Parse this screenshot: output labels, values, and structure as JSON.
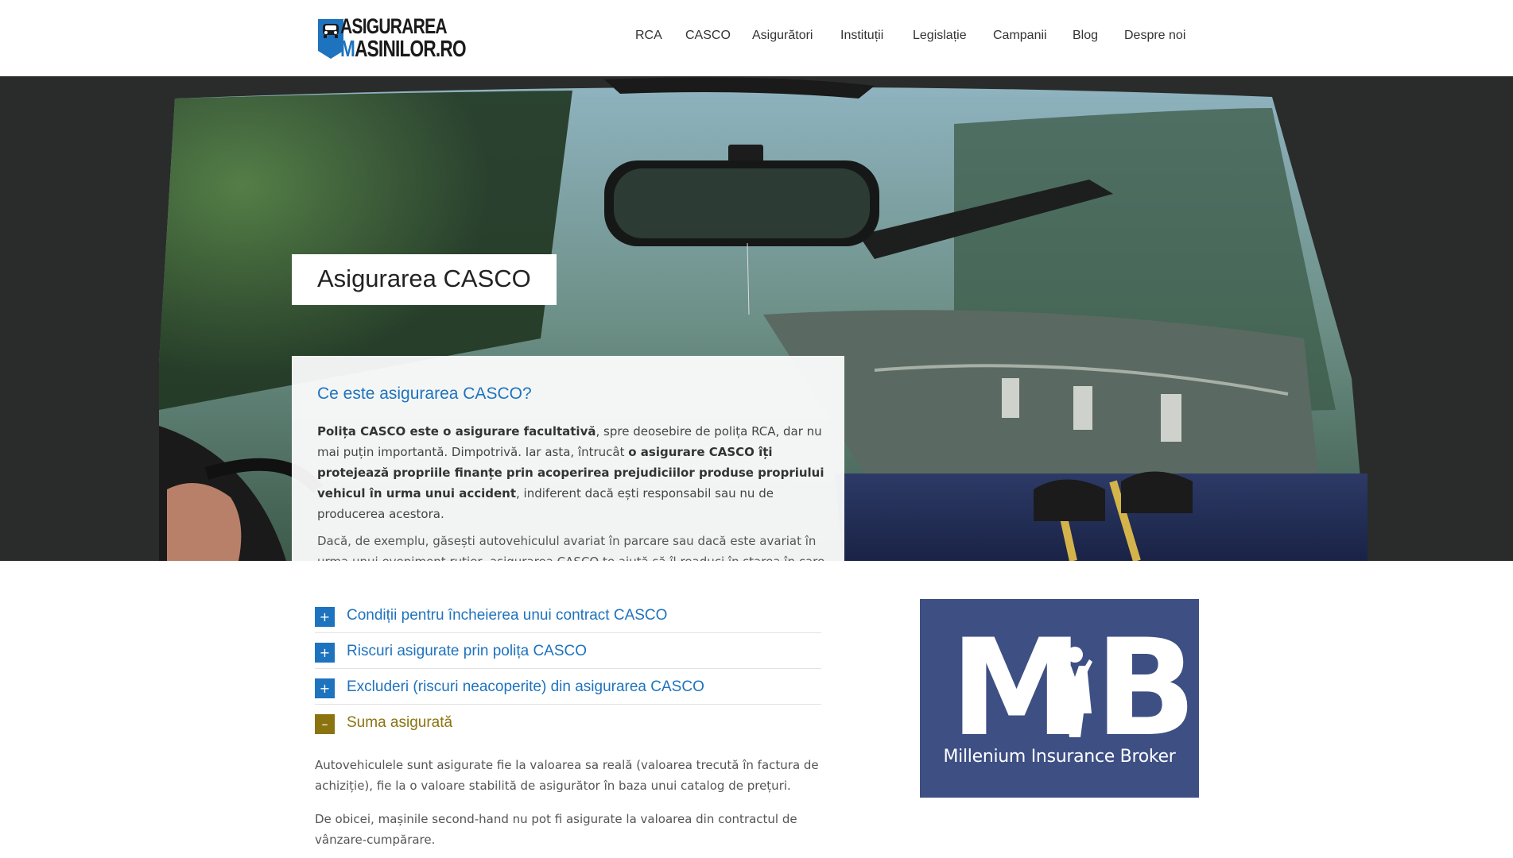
{
  "logo": {
    "line1": "ASIGURAREA",
    "line2_first": "M",
    "line2_rest": "ASINILOR.RO"
  },
  "nav": [
    "RCA",
    "CASCO",
    "Asigurători",
    "Instituții",
    "Legislație",
    "Campanii",
    "Blog",
    "Despre noi"
  ],
  "hero": {
    "title": "Asigurarea CASCO"
  },
  "intro": {
    "heading": "Ce este asigurarea CASCO?",
    "p1_bold1": "Polița CASCO este o asigurare facultativă",
    "p1_text1": ", spre deosebire de polița RCA, dar nu mai puțin importantă. Dimpotrivă. Iar asta, întrucât ",
    "p1_bold2": "o asigurare CASCO îți protejează propriile finanțe prin acoperirea prejudiciilor produse propriului vehicul în urma unui accident",
    "p1_text2": ", indiferent dacă ești responsabil sau nu de producerea acestora.",
    "p2": "Dacă, de exemplu, găsești autovehiculul avariat în parcare sau dacă este avariat în urma unui eveniment rutier, asigurarea CASCO te ajută să îl readuci în starea în care era înaintea incidentului. Totodată, polița CASCO acoperă și alte riscuri, precum furtul mașinii sau al părților componente."
  },
  "accordion": {
    "items": [
      {
        "label": "Condiții pentru încheierea unui contract CASCO",
        "toggle": "+"
      },
      {
        "label": "Riscuri asigurate prin polița CASCO",
        "toggle": "+"
      },
      {
        "label": "Excluderi (riscuri neacoperite) din asigurarea CASCO",
        "toggle": "+"
      },
      {
        "label": "Suma asigurată",
        "toggle": "–"
      }
    ],
    "open_body": [
      "Autovehiculele sunt asigurate fie la valoarea sa reală (valoarea trecută în factura de achiziție), fie la o valoare stabilită de asigurător în baza unui catalog de prețuri.",
      "De obicei, mașinile second-hand nu pot fi asigurate la valoarea din contractul de vânzare-cumpărare."
    ]
  },
  "ad": {
    "letter_m": "M",
    "letter_b": "B",
    "caption": "Millenium Insurance Broker"
  },
  "colors": {
    "link_blue": "#1e73be",
    "open_gold": "#8b7410",
    "ad_bg": "#3e4f84"
  }
}
